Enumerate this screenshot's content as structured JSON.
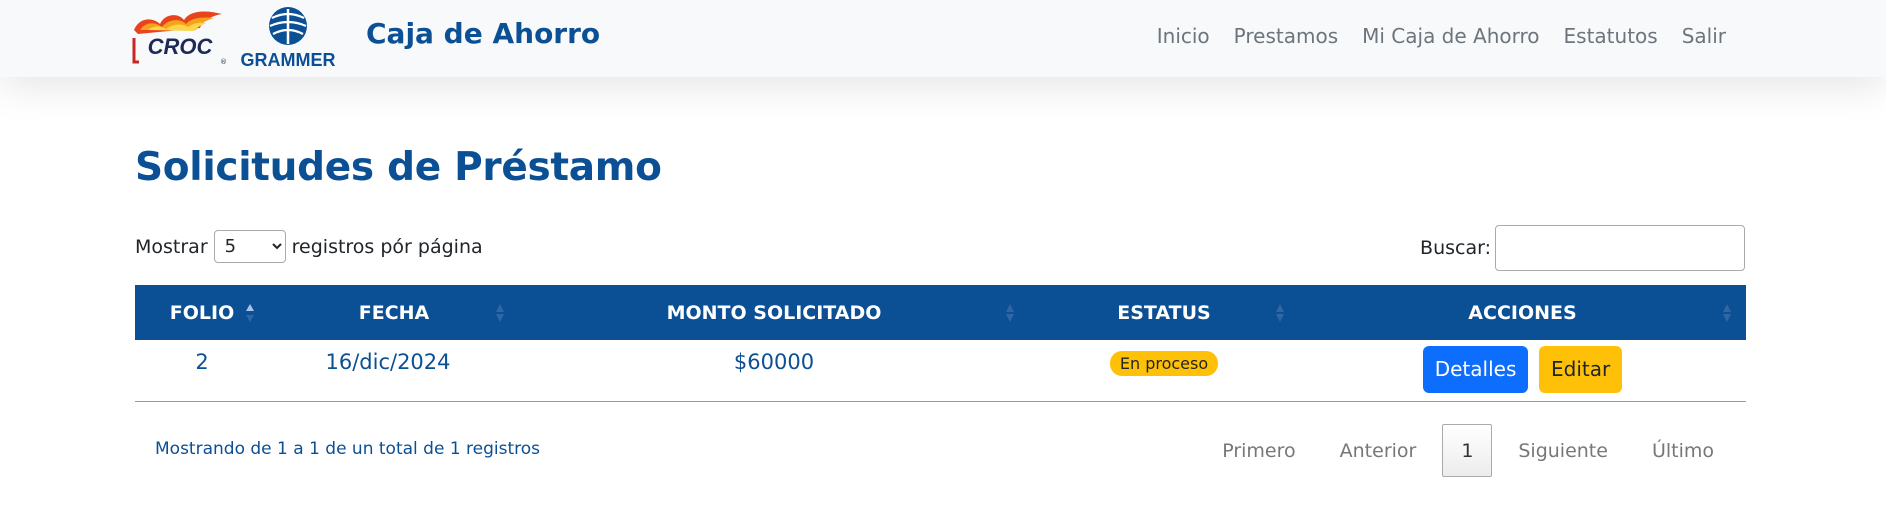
{
  "navbar": {
    "brand_logo_1": "CROC",
    "brand_logo_2": "GRAMMER",
    "title": "Caja de Ahorro",
    "links": [
      "Inicio",
      "Prestamos",
      "Mi Caja de Ahorro",
      "Estatutos",
      "Salir"
    ]
  },
  "main": {
    "title": "Solicitudes de Préstamo",
    "length": {
      "prefix": "Mostrar",
      "selected": "5",
      "suffix": "registros pór página"
    },
    "search": {
      "label": "Buscar:",
      "value": ""
    },
    "table": {
      "columns": [
        "FOLIO",
        "FECHA",
        "MONTO SOLICITADO",
        "ESTATUS",
        "ACCIONES"
      ],
      "rows": [
        {
          "folio": "2",
          "fecha": "16/dic/2024",
          "monto": "$60000",
          "estatus": "En proceso",
          "actions": [
            "Detalles",
            "Editar"
          ]
        }
      ]
    },
    "info": "Mostrando de 1 a 1 de un total de 1 registros",
    "pagination": {
      "first": "Primero",
      "previous": "Anterior",
      "current": "1",
      "next": "Siguiente",
      "last": "Último"
    }
  },
  "colors": {
    "brand_blue": "#0b4f95",
    "primary": "#0d6efd",
    "warning": "#ffc107",
    "navbar_bg": "#f8f9fa"
  }
}
